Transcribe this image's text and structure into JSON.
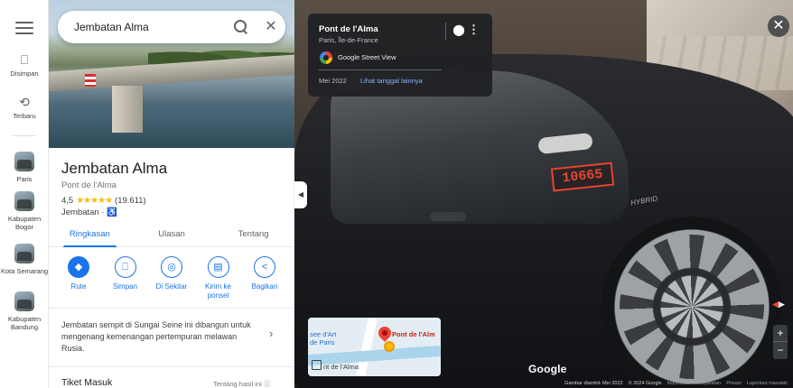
{
  "rail": {
    "saved_label": "Disimpan",
    "recent_label": "Terbaru",
    "recents": [
      {
        "label": "Paris"
      },
      {
        "label": "Kabupaten Bogor"
      },
      {
        "label": "Kota Semarang"
      },
      {
        "label": "Kabupaten Bandung"
      }
    ]
  },
  "search": {
    "value": "Jembatan Alma"
  },
  "place": {
    "title": "Jembatan Alma",
    "subtitle": "Pont de l'Alma",
    "rating": "4,5",
    "stars": "★★★★★",
    "reviews": "(19.611)",
    "category": "Jembatan ·"
  },
  "tabs": [
    "Ringkasan",
    "Ulasan",
    "Tentang"
  ],
  "actions": [
    {
      "label": "Rute",
      "icon": "directions-icon"
    },
    {
      "label": "Simpan",
      "icon": "bookmark-icon"
    },
    {
      "label": "Di Sekitar",
      "icon": "nearby-icon"
    },
    {
      "label": "Kirim ke ponsel",
      "icon": "send-to-phone-icon"
    },
    {
      "label": "Bagikan",
      "icon": "share-icon"
    }
  ],
  "description": "Jembatan sempit di Sungai Seine ini dibangun untuk mengenang kemenangan pertempuran melawan Rusia.",
  "tickets": {
    "title": "Tiket Masuk",
    "about": "Tentang hasil ini"
  },
  "streetview": {
    "place_name": "Pont de l'Alma",
    "place_location": "Paris, Île-de-France",
    "provider": "Google Street View",
    "date": "Mei 2022",
    "more_dates": "Lihat tanggal lainnya",
    "plate": "10665",
    "badge": "HYBRID",
    "watermark": "Google",
    "footer": {
      "captured": "Gambar diambil: Mei 2022",
      "copyright": "© 2024 Google",
      "region": "Indonesia",
      "terms": "Persyaratan",
      "privacy": "Privasi",
      "report": "Laporkan masalah"
    },
    "minimap": {
      "poi": "Musée d'Art moderne de Paris",
      "poi_visible": "see d'Art\nde Paris",
      "place": "Pont de l'Alm",
      "place2": "nt de l'Alma"
    }
  },
  "colors": {
    "accent": "#1a73e8",
    "star": "#fbbc04",
    "plate": "#e5452e"
  }
}
